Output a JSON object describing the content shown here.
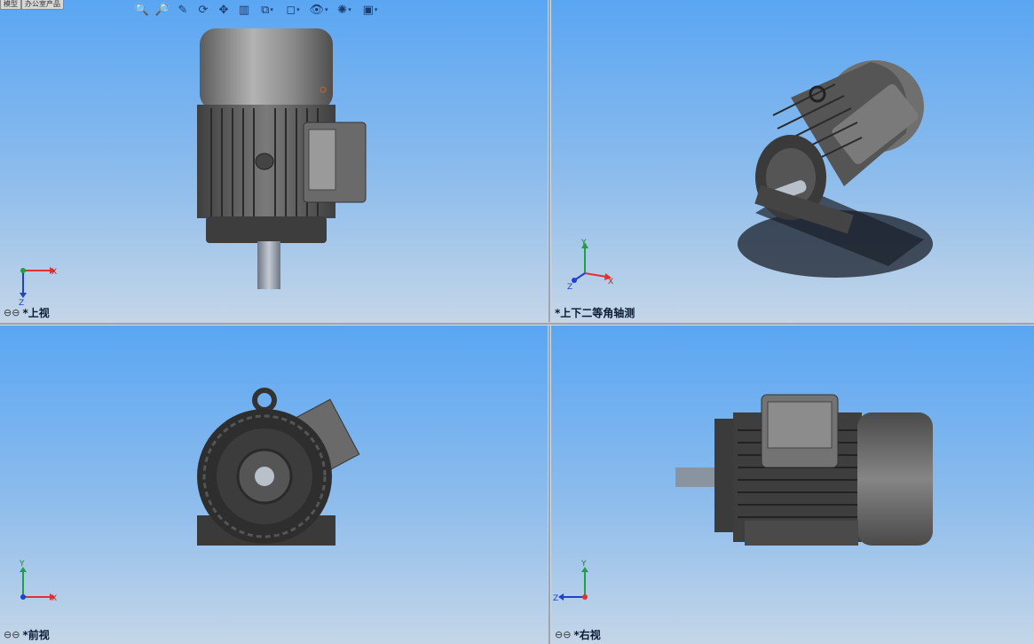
{
  "tabs": [
    "模型",
    "办公室产品"
  ],
  "toolbar": [
    {
      "name": "zoom-to-fit-icon",
      "glyph": "🔍"
    },
    {
      "name": "zoom-area-icon",
      "glyph": "🔎"
    },
    {
      "name": "select-icon",
      "glyph": "✎"
    },
    {
      "name": "rotate-icon",
      "glyph": "⟳"
    },
    {
      "name": "pan-icon",
      "glyph": "✥"
    },
    {
      "name": "section-view-icon",
      "glyph": "▥"
    },
    {
      "name": "view-orientation-icon",
      "glyph": "⧉",
      "dropdown": true
    },
    {
      "name": "display-style-icon",
      "glyph": "◻",
      "dropdown": true
    },
    {
      "name": "hide-show-icon",
      "glyph": "👁",
      "dropdown": true
    },
    {
      "name": "appearance-icon",
      "glyph": "✺",
      "dropdown": true
    },
    {
      "name": "scene-icon",
      "glyph": "▣",
      "dropdown": true
    }
  ],
  "viewports": {
    "top": {
      "label": "*上视",
      "axes": {
        "h": "X",
        "v": "Z"
      }
    },
    "iso": {
      "label": "*上下二等角轴测",
      "axes": {
        "y": "Y",
        "x": "X",
        "z": "Z"
      }
    },
    "front": {
      "label": "*前视",
      "axes": {
        "h": "X",
        "v": "Y"
      }
    },
    "right": {
      "label": "*右视",
      "axes": {
        "h": "Z",
        "v": "Y"
      }
    }
  },
  "colors": {
    "accent_x": "#e03030",
    "accent_y": "#20a040",
    "accent_z": "#2040d0",
    "background_top": "#5aa6f3",
    "background_bottom": "#c4d6e8"
  }
}
